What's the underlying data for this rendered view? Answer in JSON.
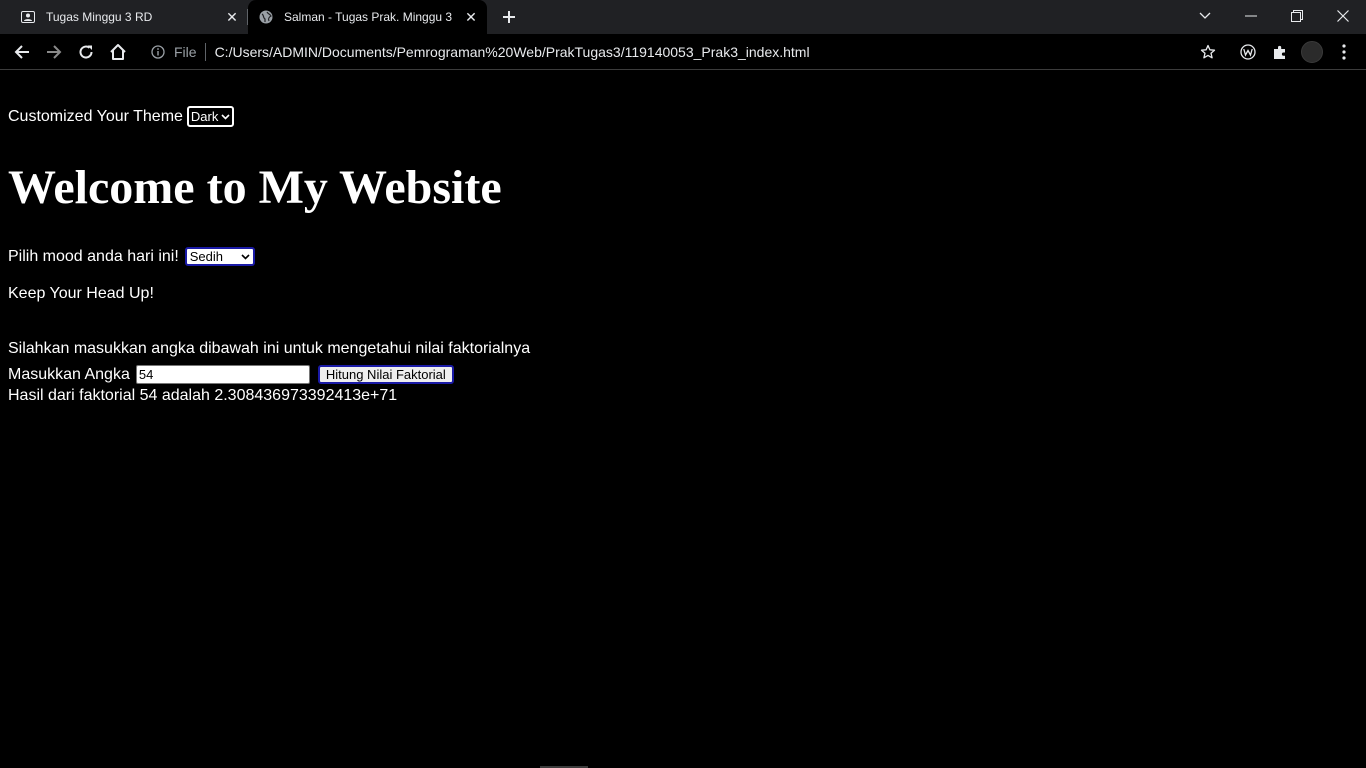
{
  "browser": {
    "tabs": [
      {
        "title": "Tugas Minggu 3 RD",
        "icon": "contact-card-icon",
        "active": false
      },
      {
        "title": "Salman - Tugas Prak. Minggu 3",
        "icon": "globe-icon",
        "active": true
      }
    ],
    "address": {
      "scheme_label": "File",
      "url": "C:/Users/ADMIN/Documents/Pemrograman%20Web/PrakTugas3/119140053_Prak3_index.html"
    }
  },
  "page": {
    "theme_label": "Customized Your Theme",
    "theme_value": "Dark",
    "title": "Welcome to My Website",
    "mood_label": "Pilih mood anda hari ini!",
    "mood_value": "Sedih",
    "mood_message": "Keep Your Head Up!",
    "factorial_intro": "Silahkan masukkan angka dibawah ini untuk mengetahui nilai faktorialnya",
    "factorial_label": "Masukkan Angka",
    "factorial_input": "54",
    "factorial_button": "Hitung Nilai Faktorial",
    "factorial_result": "Hasil dari faktorial 54 adalah 2.308436973392413e+71"
  },
  "colors": {
    "background": "#000000",
    "chrome_strip": "#202124",
    "text": "#ffffff",
    "focus_border": "#1a1aa6"
  }
}
